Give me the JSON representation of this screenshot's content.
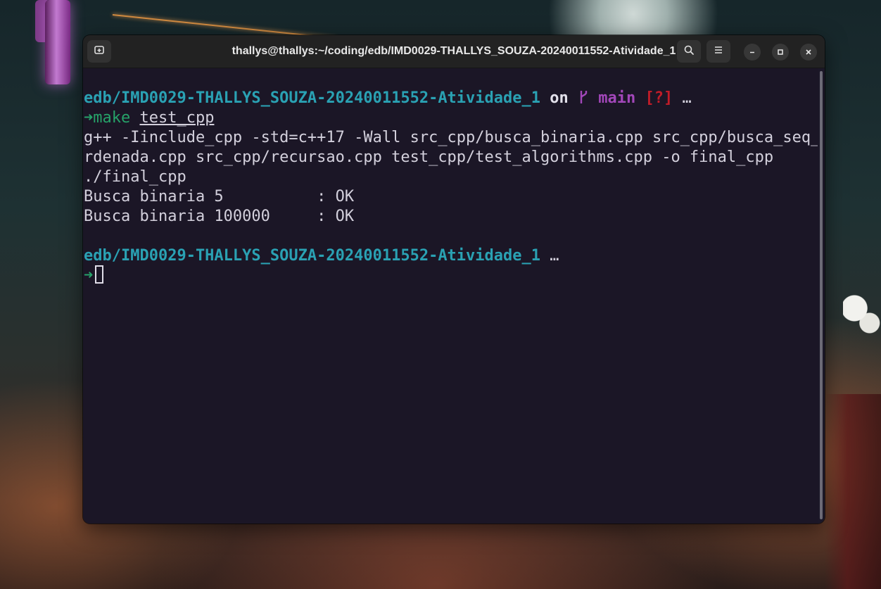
{
  "window": {
    "title": "thallys@thallys:~/coding/edb/IMD0029-THALLYS_SOUZA-20240011552-Atividade_1",
    "buttons": {
      "new_tab": "new-tab-icon",
      "search": "search-icon",
      "menu": "hamburger-menu-icon",
      "minimize": "minimize-icon",
      "maximize": "maximize-icon",
      "close": "close-icon"
    }
  },
  "terminal": {
    "prompt1": {
      "dir": "edb/IMD0029-THALLYS_SOUZA-20240011552-Atividade_1",
      "on": "on",
      "branch_icon": "",
      "branch": "main",
      "status": "[?]",
      "ellipsis": "…"
    },
    "arrow": "➜",
    "command": "make",
    "command_arg": "test_cpp",
    "output": [
      "g++ -Iinclude_cpp -std=c++17 -Wall src_cpp/busca_binaria.cpp src_cpp/busca_seq_o",
      "rdenada.cpp src_cpp/recursao.cpp test_cpp/test_algorithms.cpp -o final_cpp",
      "./final_cpp",
      "Busca binaria 5          : OK",
      "Busca binaria 100000     : OK"
    ],
    "prompt2": {
      "dir": "edb/IMD0029-THALLYS_SOUZA-20240011552-Atividade_1",
      "ellipsis": "…"
    },
    "arrow2": "➜"
  },
  "colors": {
    "terminal_bg": "#1b1727",
    "path": "#2aa1b3",
    "branch": "#a347ba",
    "status": "#c01c28",
    "arrow": "#26a269"
  }
}
